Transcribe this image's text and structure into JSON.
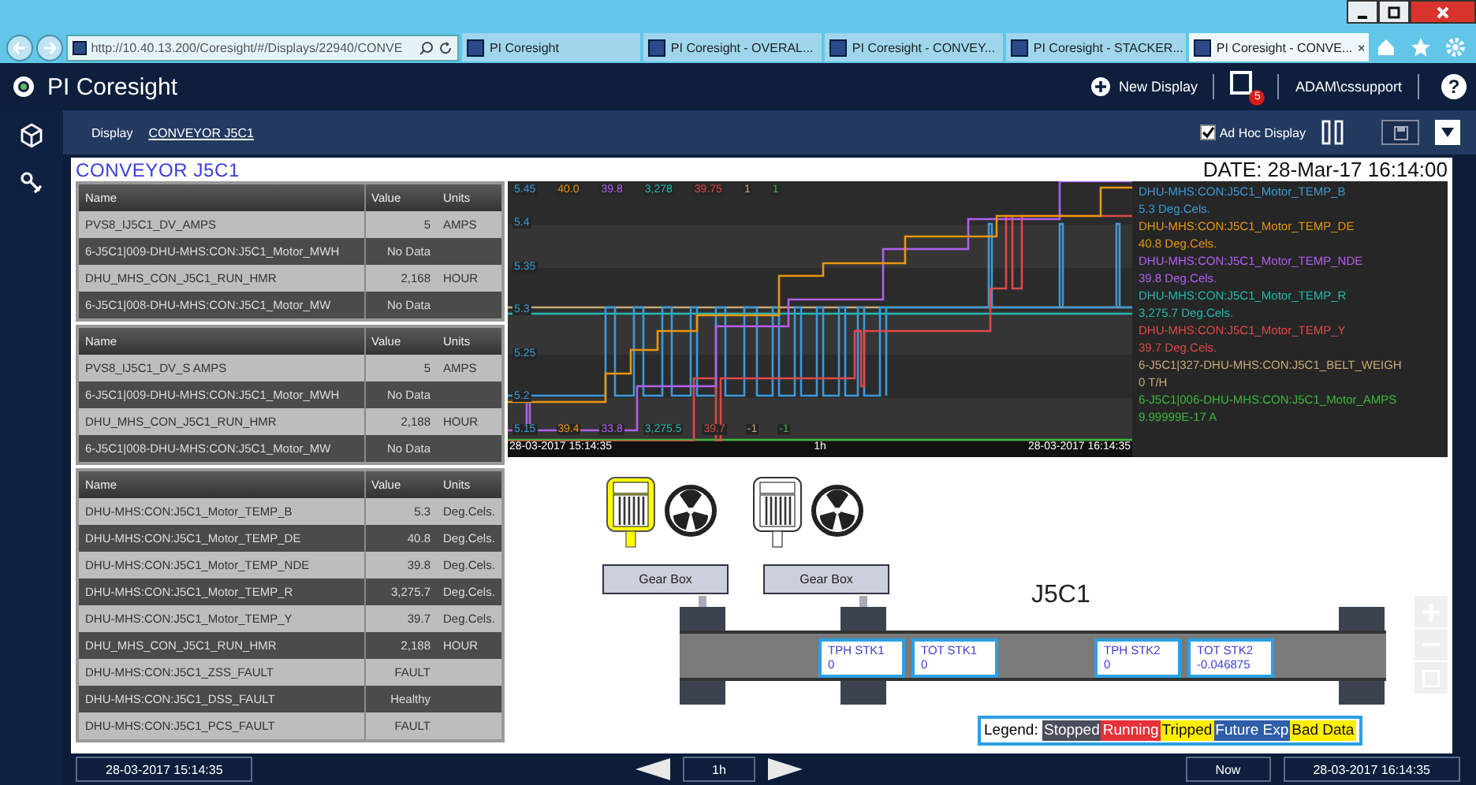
{
  "browser": {
    "address": "http://10.40.13.200/Coresight/#/Displays/22940/CONVE",
    "tabs": [
      {
        "label": "PI Coresight",
        "selected": false
      },
      {
        "label": "PI Coresight - OVERAL...",
        "selected": false
      },
      {
        "label": "PI Coresight - CONVEY...",
        "selected": false
      },
      {
        "label": "PI Coresight - STACKER...",
        "selected": false
      },
      {
        "label": "PI Coresight - CONVE...",
        "selected": true
      }
    ]
  },
  "app": {
    "title": "PI Coresight",
    "new_display": "New Display",
    "notifications": "5",
    "user": "ADAM\\cssupport",
    "help": "?"
  },
  "toolbar": {
    "label": "Display",
    "display_name": "CONVEYOR J5C1",
    "ad_hoc": {
      "label": "Ad Hoc Display",
      "checked": true
    }
  },
  "display": {
    "title": "CONVEYOR J5C1",
    "date": "DATE: 28-Mar-17 16:14:00"
  },
  "tables": [
    {
      "columns": [
        "Name",
        "Value",
        "Units"
      ],
      "rows": [
        [
          "PVS8_IJ5C1_DV_AMPS",
          "5",
          "AMPS"
        ],
        [
          "6-J5C1|009-DHU-MHS:CON:J5C1_Motor_MWH",
          "No Data",
          ""
        ],
        [
          "DHU_MHS_CON_J5C1_RUN_HMR",
          "2,168",
          "HOUR"
        ],
        [
          "6-J5C1|008-DHU-MHS:CON:J5C1_Motor_MW",
          "No Data",
          ""
        ]
      ]
    },
    {
      "columns": [
        "Name",
        "Value",
        "Units"
      ],
      "rows": [
        [
          "PVS8_IJ5C1_DV_S AMPS",
          "5",
          "AMPS"
        ],
        [
          "6-J5C1|009-DHU-MHS:CON:J5C1_Motor_MWH",
          "No Data",
          ""
        ],
        [
          "DHU_MHS_CON_J5C1_RUN_HMR",
          "2,188",
          "HOUR"
        ],
        [
          "6-J5C1|008-DHU-MHS:CON:J5C1_Motor_MW",
          "No Data",
          ""
        ]
      ]
    },
    {
      "columns": [
        "Name",
        "Value",
        "Units"
      ],
      "rows": [
        [
          "DHU-MHS:CON:J5C1_Motor_TEMP_B",
          "5.3",
          "Deg.Cels."
        ],
        [
          "DHU-MHS:CON:J5C1_Motor_TEMP_DE",
          "40.8",
          "Deg.Cels."
        ],
        [
          "DHU-MHS:CON:J5C1_Motor_TEMP_NDE",
          "39.8",
          "Deg.Cels."
        ],
        [
          "DHU-MHS:CON:J5C1_Motor_TEMP_R",
          "3,275.7",
          "Deg.Cels."
        ],
        [
          "DHU-MHS:CON:J5C1_Motor_TEMP_Y",
          "39.7",
          "Deg.Cels."
        ],
        [
          "DHU_MHS_CON_J5C1_RUN_HMR",
          "2,188",
          "HOUR"
        ],
        [
          "DHU-MHS:CON:J5C1_ZSS_FAULT",
          "FAULT",
          ""
        ],
        [
          "DHU-MHS:CON:J5C1_DSS_FAULT",
          "Healthy",
          ""
        ],
        [
          "DHU-MHS:CON:J5C1_PCS_FAULT",
          "FAULT",
          ""
        ]
      ]
    }
  ],
  "trend": {
    "top_scale": [
      {
        "text": "5.45",
        "color": "#3a9ad9"
      },
      {
        "text": "40.0",
        "color": "#e8960c"
      },
      {
        "text": "39.8",
        "color": "#b25ff0"
      },
      {
        "text": "3,278",
        "color": "#22b8b0"
      },
      {
        "text": "39.75",
        "color": "#e04848"
      },
      {
        "text": "1",
        "color": "#c8a878"
      },
      {
        "text": "1",
        "color": "#3cb83c"
      }
    ],
    "bottom_scale": [
      {
        "text": "5.15",
        "color": "#3a9ad9"
      },
      {
        "text": "39.4",
        "color": "#e8960c"
      },
      {
        "text": "33.8",
        "color": "#b25ff0"
      },
      {
        "text": "3,275.5",
        "color": "#22b8b0"
      },
      {
        "text": "39.7",
        "color": "#e04848"
      },
      {
        "text": "-1",
        "color": "#c8a878"
      },
      {
        "text": "-1",
        "color": "#3cb83c"
      }
    ],
    "axis_labels": [
      "5.4",
      "5.35",
      "5.3",
      "5.25",
      "5.2"
    ],
    "time_start": "28-03-2017 15:14:35",
    "time_span": "1h",
    "time_end": "28-03-2017 16:14:35",
    "legend": [
      {
        "name": "DHU-MHS:CON:J5C1_Motor_TEMP_B",
        "value": "5.3 Deg.Cels.",
        "color": "#3a9ad9"
      },
      {
        "name": "DHU-MHS:CON:J5C1_Motor_TEMP_DE",
        "value": "40.8 Deg.Cels.",
        "color": "#e8960c"
      },
      {
        "name": "DHU-MHS:CON:J5C1_Motor_TEMP_NDE",
        "value": "39.8 Deg.Cels.",
        "color": "#b25ff0"
      },
      {
        "name": "DHU-MHS:CON:J5C1_Motor_TEMP_R",
        "value": "3,275.7 Deg.Cels.",
        "color": "#22b8b0"
      },
      {
        "name": "DHU-MHS:CON:J5C1_Motor_TEMP_Y",
        "value": "39.7 Deg.Cels.",
        "color": "#e04848"
      },
      {
        "name": "6-J5C1|327-DHU-MHS:CON:J5C1_BELT_WEIGH",
        "value": "0 T/H",
        "color": "#c8a878"
      },
      {
        "name": "6-J5C1|006-DHU-MHS:CON:J5C1_Motor_AMPS",
        "value": "9.99999E-17 A",
        "color": "#3cb83c"
      }
    ]
  },
  "diagram": {
    "label": "J5C1",
    "motors": [
      {
        "highlighted": true
      },
      {
        "highlighted": false
      }
    ],
    "gearboxes": [
      "Gear Box",
      "Gear Box"
    ],
    "stations": [
      {
        "label": "TPH STK1",
        "value": "0"
      },
      {
        "label": "TOT STK1",
        "value": "0"
      },
      {
        "label": "TPH STK2",
        "value": "0"
      },
      {
        "label": "TOT STK2",
        "value": "-0.046875"
      }
    ],
    "legend": {
      "label": "Legend:",
      "items": [
        {
          "label": "Stopped",
          "color": "#4a4e5a"
        },
        {
          "label": "Running",
          "color": "#e8303a"
        },
        {
          "label": "Tripped",
          "color": "#ffee00"
        },
        {
          "label": "Future Exp",
          "color": "#2e5ea8"
        },
        {
          "label": "Bad Data",
          "color": "#ffee00"
        }
      ]
    }
  },
  "timebar": {
    "start": "28-03-2017 15:14:35",
    "span": "1h",
    "now": "Now",
    "end": "28-03-2017 16:14:35"
  }
}
